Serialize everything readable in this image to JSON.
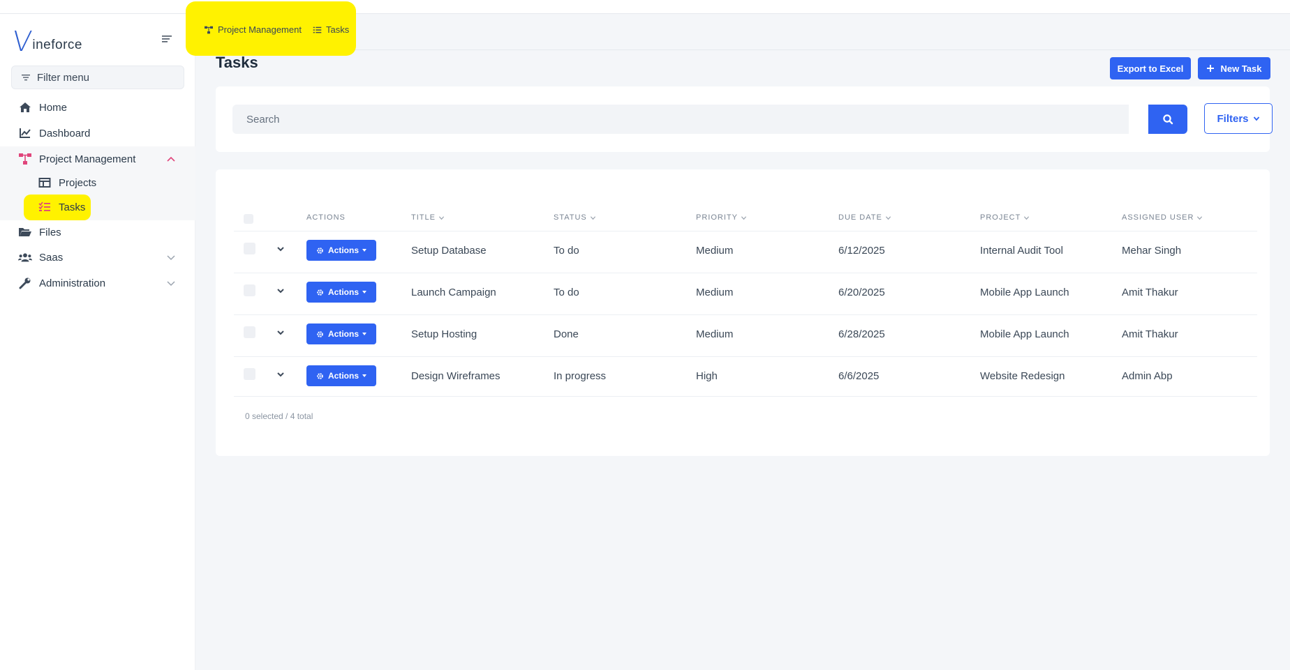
{
  "brand": {
    "logo_mark": "V",
    "logo_text": "ineforce"
  },
  "sidebar": {
    "filter_placeholder": "Filter menu",
    "items": [
      {
        "label": "Home",
        "icon": "home-icon"
      },
      {
        "label": "Dashboard",
        "icon": "chart-line-icon"
      },
      {
        "label": "Project Management",
        "icon": "sitemap-icon",
        "expanded": true
      },
      {
        "label": "Projects",
        "icon": "table-icon"
      },
      {
        "label": "Tasks",
        "icon": "tasks-list-icon"
      },
      {
        "label": "Files",
        "icon": "folder-open-icon"
      },
      {
        "label": "Saas",
        "icon": "users-icon"
      },
      {
        "label": "Administration",
        "icon": "wrench-icon"
      }
    ]
  },
  "breadcrumb": {
    "items": [
      "Project Management",
      "Tasks"
    ]
  },
  "page": {
    "title": "Tasks",
    "export_label": "Export to Excel",
    "new_task_label": "New Task",
    "search_placeholder": "Search",
    "filters_label": "Filters"
  },
  "table": {
    "columns": [
      "ACTIONS",
      "TITLE",
      "STATUS",
      "PRIORITY",
      "DUE DATE",
      "PROJECT",
      "ASSIGNED USER"
    ],
    "actions_label": "Actions",
    "rows": [
      {
        "title": "Setup Database",
        "status": "To do",
        "priority": "Medium",
        "due_date": "6/12/2025",
        "project": "Internal Audit Tool",
        "assigned_user": "Mehar Singh"
      },
      {
        "title": "Launch Campaign",
        "status": "To do",
        "priority": "Medium",
        "due_date": "6/20/2025",
        "project": "Mobile App Launch",
        "assigned_user": "Amit Thakur"
      },
      {
        "title": "Setup Hosting",
        "status": "Done",
        "priority": "Medium",
        "due_date": "6/28/2025",
        "project": "Mobile App Launch",
        "assigned_user": "Amit Thakur"
      },
      {
        "title": "Design Wireframes",
        "status": "In progress",
        "priority": "High",
        "due_date": "6/6/2025",
        "project": "Website Redesign",
        "assigned_user": "Admin Abp"
      }
    ],
    "footer": "0 selected / 4 total"
  },
  "colors": {
    "primary": "#2f63f2",
    "highlight": "#fff200",
    "accent_pink": "#e0457b"
  }
}
